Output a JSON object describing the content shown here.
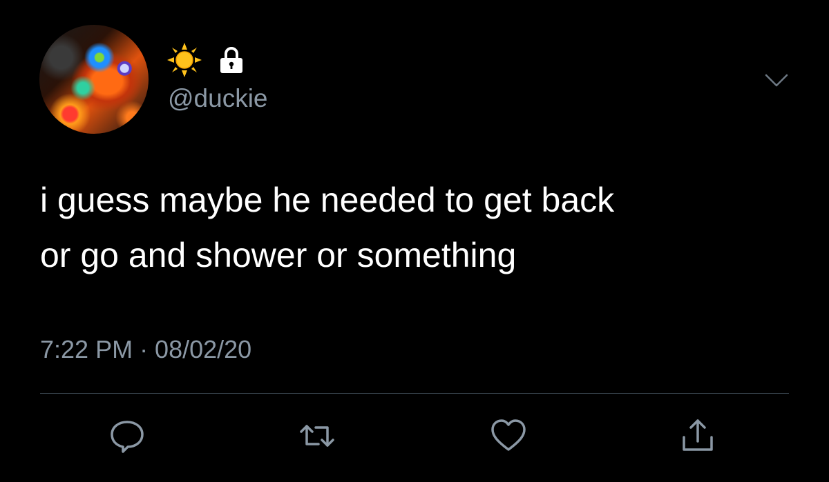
{
  "tweet": {
    "handle": "@duckie",
    "text_lines": [
      "i guess maybe he needed to get back",
      "or go and shower or something"
    ],
    "timestamp": "7:22 PM · 08/02/20"
  },
  "header": {
    "emoji_icons": [
      "sun-icon",
      "lock-icon"
    ]
  },
  "actions": [
    {
      "icon": "reply-icon"
    },
    {
      "icon": "retweet-icon"
    },
    {
      "icon": "like-icon"
    },
    {
      "icon": "share-icon"
    }
  ],
  "colors": {
    "background": "#000000",
    "primary_text": "#ffffff",
    "secondary_text": "#8b98a5",
    "divider": "#38444d",
    "sun": "#ffc21c"
  }
}
